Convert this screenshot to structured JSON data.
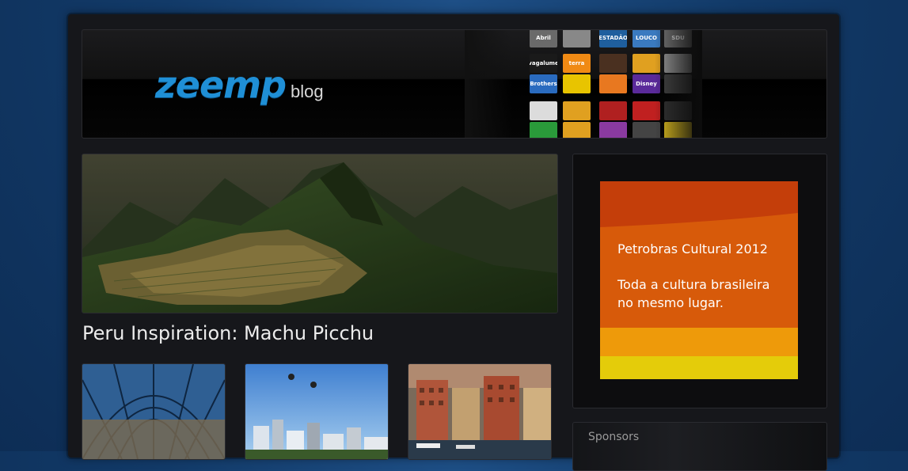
{
  "logo": {
    "main": "zeemp",
    "sub": "blog"
  },
  "header": {
    "tiles": [
      {
        "label": "Abril",
        "bg": "#6a6a6a"
      },
      {
        "label": "vagalume",
        "bg": "#1a1a1a"
      },
      {
        "label": "Brothers",
        "bg": "#2a6bbf"
      },
      {
        "label": "",
        "bg": "#dcdcdc"
      },
      {
        "label": "",
        "bg": "#2a9a3a"
      },
      {
        "label": "",
        "bg": "#888"
      },
      {
        "label": "terra",
        "bg": "#f08a14"
      },
      {
        "label": "",
        "bg": "#e8c400"
      },
      {
        "label": "",
        "bg": "#e0a020"
      },
      {
        "label": "",
        "bg": "#e0a020"
      },
      {
        "label": "ESTADÃO",
        "bg": "#1f5f9e"
      },
      {
        "label": "",
        "bg": "#4a3020"
      },
      {
        "label": "",
        "bg": "#e87820"
      },
      {
        "label": "",
        "bg": "#b02020"
      },
      {
        "label": "",
        "bg": "#8a3aa0"
      },
      {
        "label": "LOUCO",
        "bg": "#3a7ac0"
      },
      {
        "label": "",
        "bg": "#e0a020"
      },
      {
        "label": "Disney",
        "bg": "#5a2a9a"
      },
      {
        "label": "",
        "bg": "#c02020"
      },
      {
        "label": "",
        "bg": "#444"
      },
      {
        "label": "SDU",
        "bg": "#777"
      },
      {
        "label": "",
        "bg": "#999"
      },
      {
        "label": "",
        "bg": "#444"
      },
      {
        "label": "",
        "bg": "#333"
      },
      {
        "label": "",
        "bg": "#e0c020"
      }
    ]
  },
  "featured": {
    "title": "Peru Inspiration: Machu Picchu"
  },
  "ad": {
    "line1": "Petrobras Cultural 2012",
    "line2": "Toda a cultura brasileira",
    "line3": "no mesmo lugar."
  },
  "sidebar": {
    "sponsors_title": "Sponsors"
  }
}
